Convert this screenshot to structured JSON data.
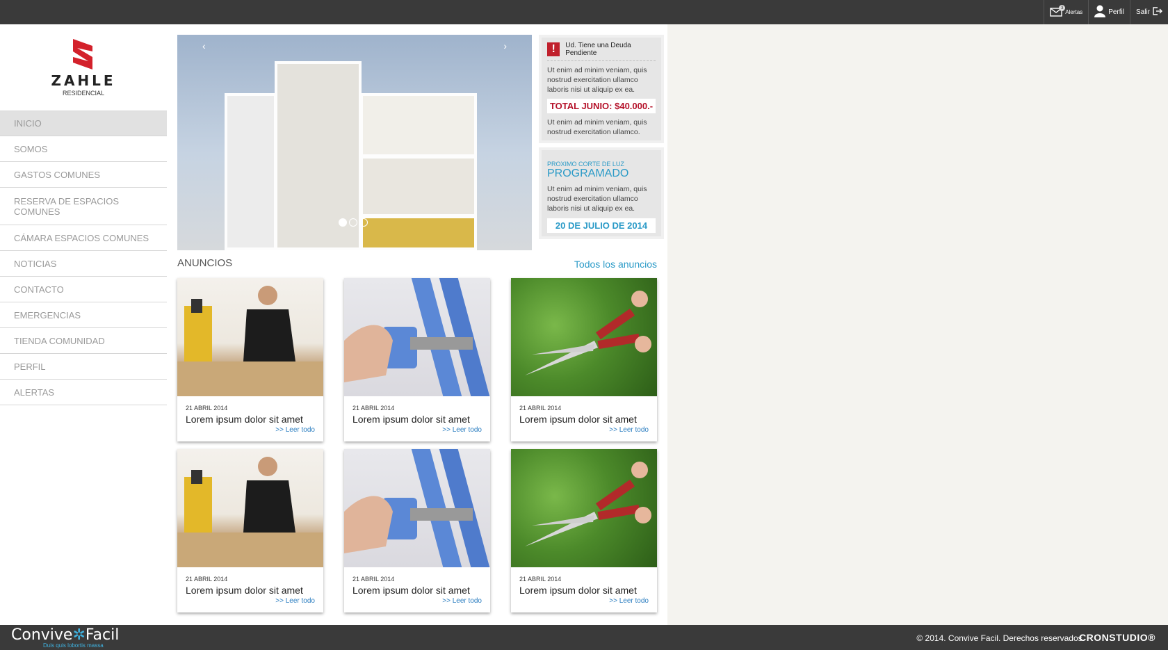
{
  "topbar": {
    "alerts_label": "Alertas",
    "alerts_count": "3",
    "profile_label": "Perfil",
    "logout_label": "Salir"
  },
  "brand": {
    "name": "ZAHLE",
    "subtitle": "RESIDENCIAL",
    "colors": {
      "logo_red": "#d3212b",
      "accent_blue": "#2a9ac7",
      "alert_red": "#b5122a"
    }
  },
  "nav": {
    "items": [
      {
        "label": "INICIO"
      },
      {
        "label": "SOMOS"
      },
      {
        "label": "GASTOS COMUNES"
      },
      {
        "label": "RESERVA DE ESPACIOS COMUNES"
      },
      {
        "label": "CÁMARA ESPACIOS COMUNES"
      },
      {
        "label": "NOTICIAS"
      },
      {
        "label": "CONTACTO"
      },
      {
        "label": "EMERGENCIAS"
      },
      {
        "label": "TIENDA COMUNIDAD"
      },
      {
        "label": "PERFIL"
      },
      {
        "label": "ALERTAS"
      }
    ]
  },
  "slider": {
    "prev": "‹",
    "next": "›",
    "active_index": 0
  },
  "debt_card": {
    "title": "Ud. Tiene una Deuda Pendiente",
    "text1": "Ut enim ad minim veniam, quis nostrud exercitation ullamco laboris nisi ut aliquip ex ea.",
    "total": "TOTAL JUNIO: $40.000.-",
    "text2": "Ut enim ad minim veniam, quis nostrud exercitation ullamco."
  },
  "power_card": {
    "subtitle": "PROXIMO CORTE DE LUZ",
    "title": "PROGRAMADO",
    "text": "Ut enim ad minim veniam, quis nostrud exercitation ullamco laboris nisi ut aliquip ex ea.",
    "date": "20 DE JULIO DE 2014"
  },
  "announcements": {
    "title": "ANUNCIOS",
    "all_link": "Todos los anuncios",
    "items": [
      {
        "date": "21 ABRIL 2014",
        "title": "Lorem ipsum dolor sit amet",
        "more": ">> Leer todo",
        "image": "carpenter"
      },
      {
        "date": "21 ABRIL 2014",
        "title": "Lorem ipsum dolor sit amet",
        "more": ">> Leer todo",
        "image": "pipe"
      },
      {
        "date": "21 ABRIL 2014",
        "title": "Lorem ipsum dolor sit amet",
        "more": ">> Leer todo",
        "image": "hedge"
      },
      {
        "date": "21 ABRIL 2014",
        "title": "Lorem ipsum dolor sit amet",
        "more": ">> Leer todo",
        "image": "carpenter"
      },
      {
        "date": "21 ABRIL 2014",
        "title": "Lorem ipsum dolor sit amet",
        "more": ">> Leer todo",
        "image": "pipe"
      },
      {
        "date": "21 ABRIL 2014",
        "title": "Lorem ipsum dolor sit amet",
        "more": ">> Leer todo",
        "image": "hedge"
      }
    ]
  },
  "footer": {
    "logo_a": "Convive",
    "logo_b": "Facil",
    "tagline": "Duis quis lobortis massa",
    "copyright": "© 2014. Convive Facil. Derechos reservados.",
    "studio": "CRONSTUDIO®"
  }
}
